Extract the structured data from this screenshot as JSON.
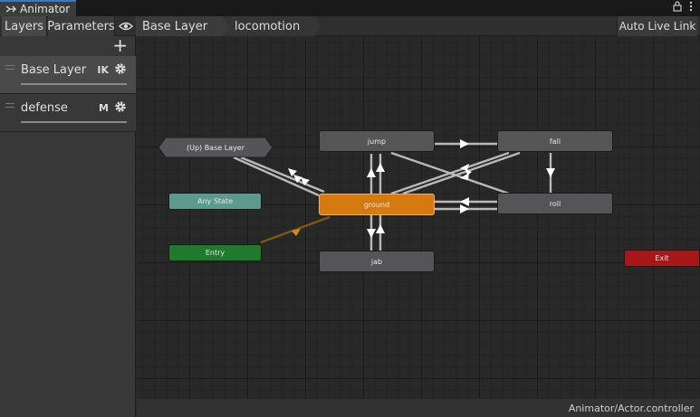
{
  "window": {
    "title": "Animator",
    "lock_icon": "lock-icon",
    "menu_icon": "kebab-menu-icon"
  },
  "toolbar": {
    "tabs": [
      {
        "label": "Layers",
        "active": true
      },
      {
        "label": "Parameters",
        "active": false
      }
    ],
    "eye_icon": "eye-icon",
    "breadcrumb": [
      "Base Layer",
      "locomotion"
    ],
    "auto_live_link": "Auto Live Link"
  },
  "layers": {
    "add_icon": "plus-icon",
    "items": [
      {
        "name": "Base Layer",
        "flag": "IK",
        "selected": true
      },
      {
        "name": "defense",
        "flag": "M",
        "selected": false
      }
    ]
  },
  "graph": {
    "states": {
      "up_base_layer": "(Up) Base Layer",
      "any_state": "Any State",
      "entry": "Entry",
      "exit": "Exit",
      "jump": "jump",
      "fall": "fall",
      "ground": "ground",
      "roll": "roll",
      "jab": "jab"
    },
    "default_state": "ground"
  },
  "status": {
    "path": "Animator/Actor.controller"
  },
  "colors": {
    "accent": "#3a79bb",
    "default_state": "#d57a10",
    "any_state": "#5c9a8e",
    "entry": "#1f7a2e",
    "exit": "#a81818",
    "state": "#555558"
  }
}
